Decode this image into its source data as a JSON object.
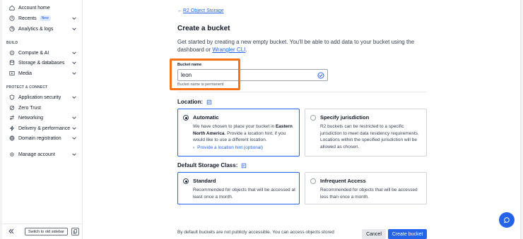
{
  "sidebar": {
    "items": [
      {
        "label": "Account home",
        "icon": "home-icon",
        "chevron": false
      },
      {
        "label": "Recents",
        "icon": "clock-icon",
        "badge": "New",
        "chevron": true
      },
      {
        "label": "Analytics & logs",
        "icon": "chart-icon",
        "chevron": true
      }
    ],
    "build_header": "BUILD",
    "build_items": [
      {
        "label": "Compute & AI",
        "icon": "compute-icon"
      },
      {
        "label": "Storage & databases",
        "icon": "database-icon"
      },
      {
        "label": "Media",
        "icon": "media-icon"
      }
    ],
    "protect_header": "PROTECT & CONNECT",
    "protect_items": [
      {
        "label": "Application security",
        "icon": "shield-icon"
      },
      {
        "label": "Zero Trust",
        "icon": "zero-trust-icon"
      },
      {
        "label": "Networking",
        "icon": "network-icon"
      },
      {
        "label": "Delivery & performance",
        "icon": "bolt-icon"
      },
      {
        "label": "Domain registration",
        "icon": "globe-icon"
      }
    ],
    "manage_item": {
      "label": "Manage account",
      "icon": "gear-icon"
    },
    "old_sidebar_label": "Switch to old sidebar"
  },
  "main": {
    "back_link": "R2 Object Storage",
    "title": "Create a bucket",
    "description": "Get started by creating a new empty bucket. You'll be able to add data to your bucket using the dashboard or",
    "description_link": "Wrangler CLI",
    "description_end": ".",
    "bucket_label": "Bucket name",
    "bucket_value": "leon",
    "bucket_helper": "Bucket name is permanent",
    "location_title": "Location:",
    "location_options": [
      {
        "title": "Automatic",
        "text_pre": "We have chosen to place your bucket in ",
        "text_bold": "Eastern North America",
        "text_post": ". Provide a location hint, if you would like to use a different location.",
        "link": "Provide a location hint (optional)",
        "selected": true
      },
      {
        "title": "Specify jurisdiction",
        "text": "R2 buckets can be restricted to a specific jurisdiction to meet data residency requirements. Locations within the specified jurisdiction will be allowed as chosen.",
        "selected": false
      }
    ],
    "storage_title": "Default Storage Class:",
    "storage_options": [
      {
        "title": "Standard",
        "text": "Recommended for objects that will be accessed at least once a month.",
        "selected": true
      },
      {
        "title": "Infrequent Access",
        "text": "Recommended for objects that will be accessed less than once a month.",
        "selected": false
      }
    ],
    "footer_text": "By default buckets are not publicly accessible. You can access objects stored",
    "cancel_label": "Cancel",
    "create_label": "Create bucket"
  },
  "colors": {
    "accent": "#2563eb",
    "highlight": "#f97316"
  }
}
